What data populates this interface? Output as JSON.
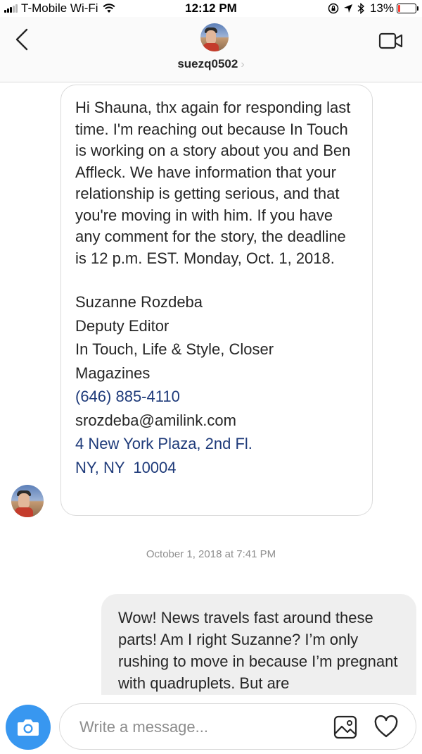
{
  "status_bar": {
    "carrier": "T-Mobile Wi-Fi",
    "time": "12:12 PM",
    "battery_percent": "13%",
    "battery_level": 0.13,
    "icons": [
      "signal-icon",
      "wifi-icon",
      "screen-lock-icon",
      "location-arrow-icon",
      "bluetooth-icon",
      "battery-icon"
    ]
  },
  "header": {
    "username": "suezq0502",
    "chevron": "›",
    "icons": [
      "back-chevron-icon",
      "video-camera-icon"
    ]
  },
  "received_message": {
    "body": "Hi Shauna, thx again for responding last time. I'm reaching out because In Touch is working on a story about you and Ben Affleck. We have information that your relationship is getting serious, and that you're moving in with him. If you have any comment for the story, the deadline is 12 p.m. EST. Monday, Oct. 1, 2018.",
    "signature": {
      "name": "Suzanne Rozdeba",
      "title": "Deputy Editor",
      "company_line1": "In Touch, Life & Style, Closer",
      "company_line2": "Magazines",
      "phone": "(646) 885-4110",
      "email": "srozdeba@amilink.com",
      "address_line1": "4 New York Plaza, 2nd Fl.",
      "address_line2": "NY, NY  10004"
    },
    "link_color": "#1f3b7a"
  },
  "timestamp": "October 1, 2018 at 7:41 PM",
  "sent_message": {
    "body": "Wow! News travels fast around these parts! Am I right Suzanne? I’m only rushing to move in because I’m pregnant with quadruplets. But are"
  },
  "composer": {
    "placeholder": "Write a message...",
    "accent_color": "#3897f0",
    "icons": [
      "camera-icon",
      "gallery-icon",
      "heart-icon"
    ]
  }
}
